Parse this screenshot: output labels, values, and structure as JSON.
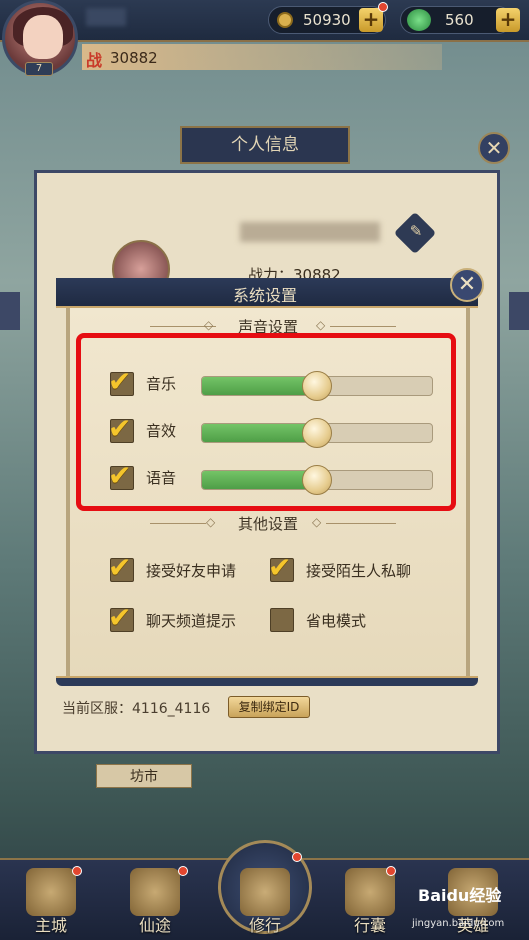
{
  "hud": {
    "level": "7",
    "power_glyph": "战",
    "power_value": "30882",
    "coins": "50930",
    "jade": "560",
    "plus": "+"
  },
  "info_panel": {
    "title": "个人信息",
    "power_text": "战力：30882",
    "server_text": "当前区服：4116_4116",
    "copy_id_label": "复制绑定ID",
    "close_glyph": "✕",
    "edit_glyph": "✎"
  },
  "settings": {
    "title": "系统设置",
    "close_glyph": "✕",
    "sound_section": "声音设置",
    "other_section": "其他设置",
    "check_glyph": "✔",
    "sound_options": [
      {
        "label": "音乐",
        "checked": true,
        "level": 0.5
      },
      {
        "label": "音效",
        "checked": true,
        "level": 0.5
      },
      {
        "label": "语音",
        "checked": true,
        "level": 0.5
      }
    ],
    "other_options": [
      {
        "label": "接受好友申请",
        "checked": true
      },
      {
        "label": "接受陌生人私聊",
        "checked": true
      },
      {
        "label": "聊天频道提示",
        "checked": true
      },
      {
        "label": "省电模式",
        "checked": false
      }
    ]
  },
  "background": {
    "fangshi": "坊市"
  },
  "nav": {
    "items": [
      "主城",
      "仙途",
      "修行",
      "行囊",
      "英雄"
    ]
  },
  "watermark": {
    "text": "Baidu经验",
    "url": "jingyan.baidu.com"
  },
  "colors": {
    "highlight": "#e60d12",
    "slider_fill": "#5fb257",
    "checkmark": "#f4c52c"
  }
}
